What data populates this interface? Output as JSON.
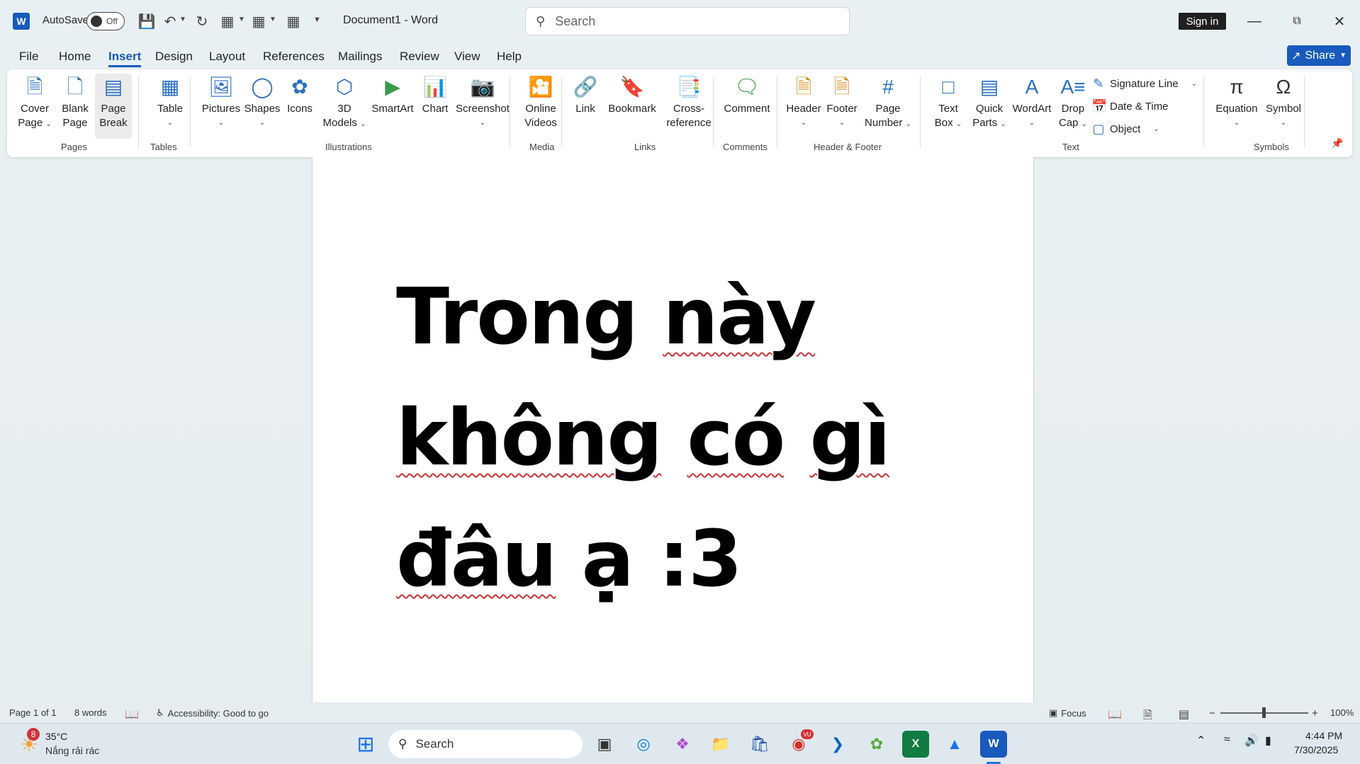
{
  "titlebar": {
    "autosave_label": "AutoSave",
    "autosave_state": "Off",
    "doc_title": "Document1  -  Word",
    "search_placeholder": "Search",
    "signin_label": "Sign in"
  },
  "menu": {
    "tabs": [
      "File",
      "Home",
      "Insert",
      "Design",
      "Layout",
      "References",
      "Mailings",
      "Review",
      "View",
      "Help"
    ],
    "active": "Insert",
    "share_label": "Share"
  },
  "ribbon": {
    "cover_page": [
      "Cover",
      "Page"
    ],
    "blank_page": [
      "Blank",
      "Page"
    ],
    "page_break": [
      "Page",
      "Break"
    ],
    "table": "Table",
    "pictures": "Pictures",
    "shapes": "Shapes",
    "icons": "Icons",
    "models_3d": [
      "3D",
      "Models"
    ],
    "smartart": "SmartArt",
    "chart": "Chart",
    "screenshot": "Screenshot",
    "online_videos": [
      "Online",
      "Videos"
    ],
    "link": "Link",
    "bookmark": "Bookmark",
    "cross_reference": [
      "Cross-",
      "reference"
    ],
    "comment": "Comment",
    "header": "Header",
    "footer": "Footer",
    "page_number": [
      "Page",
      "Number"
    ],
    "text_box": [
      "Text",
      "Box"
    ],
    "quick_parts": [
      "Quick",
      "Parts"
    ],
    "wordart": "WordArt",
    "drop_cap": [
      "Drop",
      "Cap"
    ],
    "signature_line": "Signature Line",
    "date_time": "Date & Time",
    "object": "Object",
    "equation": "Equation",
    "symbol": "Symbol",
    "groups": {
      "pages": "Pages",
      "tables": "Tables",
      "illustrations": "Illustrations",
      "media": "Media",
      "links": "Links",
      "comments": "Comments",
      "header_footer": "Header & Footer",
      "text": "Text",
      "symbols": "Symbols"
    }
  },
  "document": {
    "line1_a": "Trong",
    "line1_b": "này",
    "line2_a": "không",
    "line2_b": "có",
    "line2_c": "gì",
    "line3_a": "đâu",
    "line3_b": "ạ",
    "line3_c": ":3"
  },
  "statusbar": {
    "page": "Page 1 of 1",
    "words": "8 words",
    "accessibility": "Accessibility: Good to go",
    "focus": "Focus",
    "zoom": "100%"
  },
  "taskbar": {
    "weather_temp": "35°C",
    "weather_desc": "Nắng rải rác",
    "weather_badge": "8",
    "search_label": "Search",
    "chrome_badge": "VU",
    "time": "4:44 PM",
    "date": "7/30/2025"
  }
}
